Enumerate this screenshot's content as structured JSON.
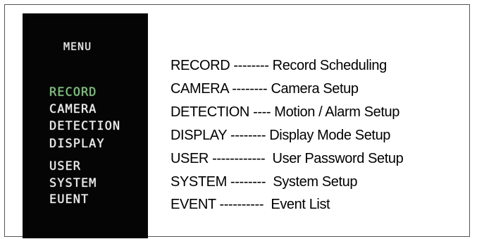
{
  "osd_menu": {
    "title": "MENU",
    "items": [
      {
        "label": "RECORD",
        "active": true
      },
      {
        "label": "CAMERA",
        "active": false
      },
      {
        "label": "DETECTION",
        "active": false
      },
      {
        "label": "DISPLAY",
        "active": false
      },
      {
        "label": "USER",
        "active": false
      },
      {
        "label": "SYSTEM",
        "active": false
      },
      {
        "label": "EUENT",
        "active": false
      }
    ],
    "active_color": "#7ec27e",
    "text_color": "#f0f0f0",
    "background": "#050505"
  },
  "legend": [
    "RECORD -------- Record Scheduling",
    "CAMERA -------- Camera Setup",
    "DETECTION ---- Motion / Alarm Setup",
    "DISPLAY -------- Display Mode Setup",
    "USER ------------  User Password Setup",
    "SYSTEM --------  System Setup",
    "EVENT ----------  Event List"
  ]
}
